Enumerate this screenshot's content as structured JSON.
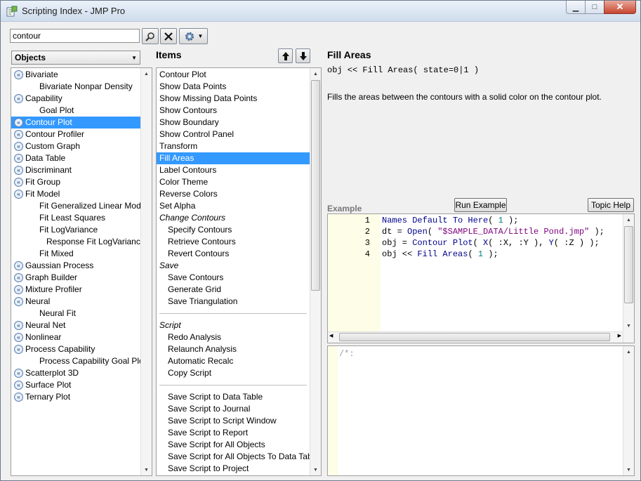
{
  "window": {
    "title": "Scripting Index - JMP Pro",
    "minimize": "▁",
    "maximize": "□",
    "close": "✕"
  },
  "toolbar": {
    "search_value": "contour",
    "search_icon": "magnifier-icon",
    "clear_icon": "x-icon",
    "options_icon": "gear-icon"
  },
  "objects_dropdown": {
    "selected": "Objects",
    "arrow": "▼"
  },
  "objects": [
    {
      "label": "Bivariate",
      "icon": true,
      "indent": 0
    },
    {
      "label": "Bivariate Nonpar Density",
      "icon": false,
      "indent": 1
    },
    {
      "label": "Capability",
      "icon": true,
      "indent": 0
    },
    {
      "label": "Goal Plot",
      "icon": false,
      "indent": 1
    },
    {
      "label": "Contour Plot",
      "icon": true,
      "indent": 0,
      "selected": true
    },
    {
      "label": "Contour Profiler",
      "icon": true,
      "indent": 0
    },
    {
      "label": "Custom Graph",
      "icon": true,
      "indent": 0
    },
    {
      "label": "Data Table",
      "icon": true,
      "indent": 0
    },
    {
      "label": "Discriminant",
      "icon": true,
      "indent": 0
    },
    {
      "label": "Fit Group",
      "icon": true,
      "indent": 0
    },
    {
      "label": "Fit Model",
      "icon": true,
      "indent": 0
    },
    {
      "label": "Fit Generalized Linear Model",
      "icon": false,
      "indent": 1
    },
    {
      "label": "Fit Least Squares",
      "icon": false,
      "indent": 1
    },
    {
      "label": "Fit LogVariance",
      "icon": false,
      "indent": 1
    },
    {
      "label": "Response Fit LogVariance",
      "icon": false,
      "indent": 2
    },
    {
      "label": "Fit Mixed",
      "icon": false,
      "indent": 1
    },
    {
      "label": "Gaussian Process",
      "icon": true,
      "indent": 0
    },
    {
      "label": "Graph Builder",
      "icon": true,
      "indent": 0
    },
    {
      "label": "Mixture Profiler",
      "icon": true,
      "indent": 0
    },
    {
      "label": "Neural",
      "icon": true,
      "indent": 0
    },
    {
      "label": "Neural Fit",
      "icon": false,
      "indent": 1
    },
    {
      "label": "Neural Net",
      "icon": true,
      "indent": 0
    },
    {
      "label": "Nonlinear",
      "icon": true,
      "indent": 0
    },
    {
      "label": "Process Capability",
      "icon": true,
      "indent": 0
    },
    {
      "label": "Process Capability Goal Plot",
      "icon": false,
      "indent": 1
    },
    {
      "label": "Scatterplot 3D",
      "icon": true,
      "indent": 0
    },
    {
      "label": "Surface Plot",
      "icon": true,
      "indent": 0
    },
    {
      "label": "Ternary Plot",
      "icon": true,
      "indent": 0
    }
  ],
  "items_header": "Items",
  "items_up_icon": "up-arrow-icon",
  "items_down_icon": "down-arrow-icon",
  "items": [
    {
      "label": "Contour Plot",
      "type": "item",
      "indent": 0
    },
    {
      "label": "Show Data Points",
      "type": "item",
      "indent": 0
    },
    {
      "label": "Show Missing Data Points",
      "type": "item",
      "indent": 0
    },
    {
      "label": "Show Contours",
      "type": "item",
      "indent": 0
    },
    {
      "label": "Show Boundary",
      "type": "item",
      "indent": 0
    },
    {
      "label": "Show Control Panel",
      "type": "item",
      "indent": 0
    },
    {
      "label": "Transform",
      "type": "item",
      "indent": 0
    },
    {
      "label": "Fill Areas",
      "type": "item",
      "indent": 0,
      "selected": true
    },
    {
      "label": "Label Contours",
      "type": "item",
      "indent": 0
    },
    {
      "label": "Color Theme",
      "type": "item",
      "indent": 0
    },
    {
      "label": "Reverse Colors",
      "type": "item",
      "indent": 0
    },
    {
      "label": "Set Alpha",
      "type": "item",
      "indent": 0
    },
    {
      "label": "Change Contours",
      "type": "group",
      "indent": 0
    },
    {
      "label": "Specify Contours",
      "type": "item",
      "indent": 1
    },
    {
      "label": "Retrieve Contours",
      "type": "item",
      "indent": 1
    },
    {
      "label": "Revert Contours",
      "type": "item",
      "indent": 1
    },
    {
      "label": "Save",
      "type": "group",
      "indent": 0
    },
    {
      "label": "Save Contours",
      "type": "item",
      "indent": 1
    },
    {
      "label": "Generate Grid",
      "type": "item",
      "indent": 1
    },
    {
      "label": "Save Triangulation",
      "type": "item",
      "indent": 1
    },
    {
      "label": "",
      "type": "separator",
      "indent": 0
    },
    {
      "label": "Script",
      "type": "group",
      "indent": 0
    },
    {
      "label": "Redo Analysis",
      "type": "item",
      "indent": 1
    },
    {
      "label": "Relaunch Analysis",
      "type": "item",
      "indent": 1
    },
    {
      "label": "Automatic Recalc",
      "type": "item",
      "indent": 1
    },
    {
      "label": "Copy Script",
      "type": "item",
      "indent": 1
    },
    {
      "label": "",
      "type": "separator",
      "indent": 0
    },
    {
      "label": "Save Script to Data Table",
      "type": "item",
      "indent": 1
    },
    {
      "label": "Save Script to Journal",
      "type": "item",
      "indent": 1
    },
    {
      "label": "Save Script to Script Window",
      "type": "item",
      "indent": 1
    },
    {
      "label": "Save Script to Report",
      "type": "item",
      "indent": 1
    },
    {
      "label": "Save Script for All Objects",
      "type": "item",
      "indent": 1
    },
    {
      "label": "Save Script for All Objects To Data Table",
      "type": "item",
      "indent": 1
    },
    {
      "label": "Save Script to Project",
      "type": "item",
      "indent": 1
    }
  ],
  "detail": {
    "title": "Fill Areas",
    "syntax": "obj << Fill Areas( state=0|1 )",
    "description": "Fills the areas between the contours with a solid color on the contour plot.",
    "example_label": "Example",
    "run_button": "Run Example",
    "topic_button": "Topic Help"
  },
  "code_lines": [
    {
      "n": "1",
      "parts": [
        [
          "kw",
          "Names Default To Here"
        ],
        [
          "p",
          "( "
        ],
        [
          "num",
          "1"
        ],
        [
          "p",
          " );"
        ]
      ]
    },
    {
      "n": "2",
      "parts": [
        [
          "p",
          "dt = "
        ],
        [
          "kw",
          "Open"
        ],
        [
          "p",
          "( "
        ],
        [
          "str",
          "\"$SAMPLE_DATA/Little Pond.jmp\""
        ],
        [
          "p",
          " );"
        ]
      ]
    },
    {
      "n": "3",
      "parts": [
        [
          "p",
          "obj = "
        ],
        [
          "kw",
          "Contour Plot"
        ],
        [
          "p",
          "( "
        ],
        [
          "kw",
          "X"
        ],
        [
          "p",
          "( :X, :Y ), "
        ],
        [
          "kw",
          "Y"
        ],
        [
          "p",
          "( :Z ) );"
        ]
      ]
    },
    {
      "n": "4",
      "parts": [
        [
          "p",
          "obj << "
        ],
        [
          "kw",
          "Fill Areas"
        ],
        [
          "p",
          "( "
        ],
        [
          "num",
          "1"
        ],
        [
          "p",
          " );"
        ]
      ]
    }
  ],
  "log": {
    "text": "/*:"
  }
}
